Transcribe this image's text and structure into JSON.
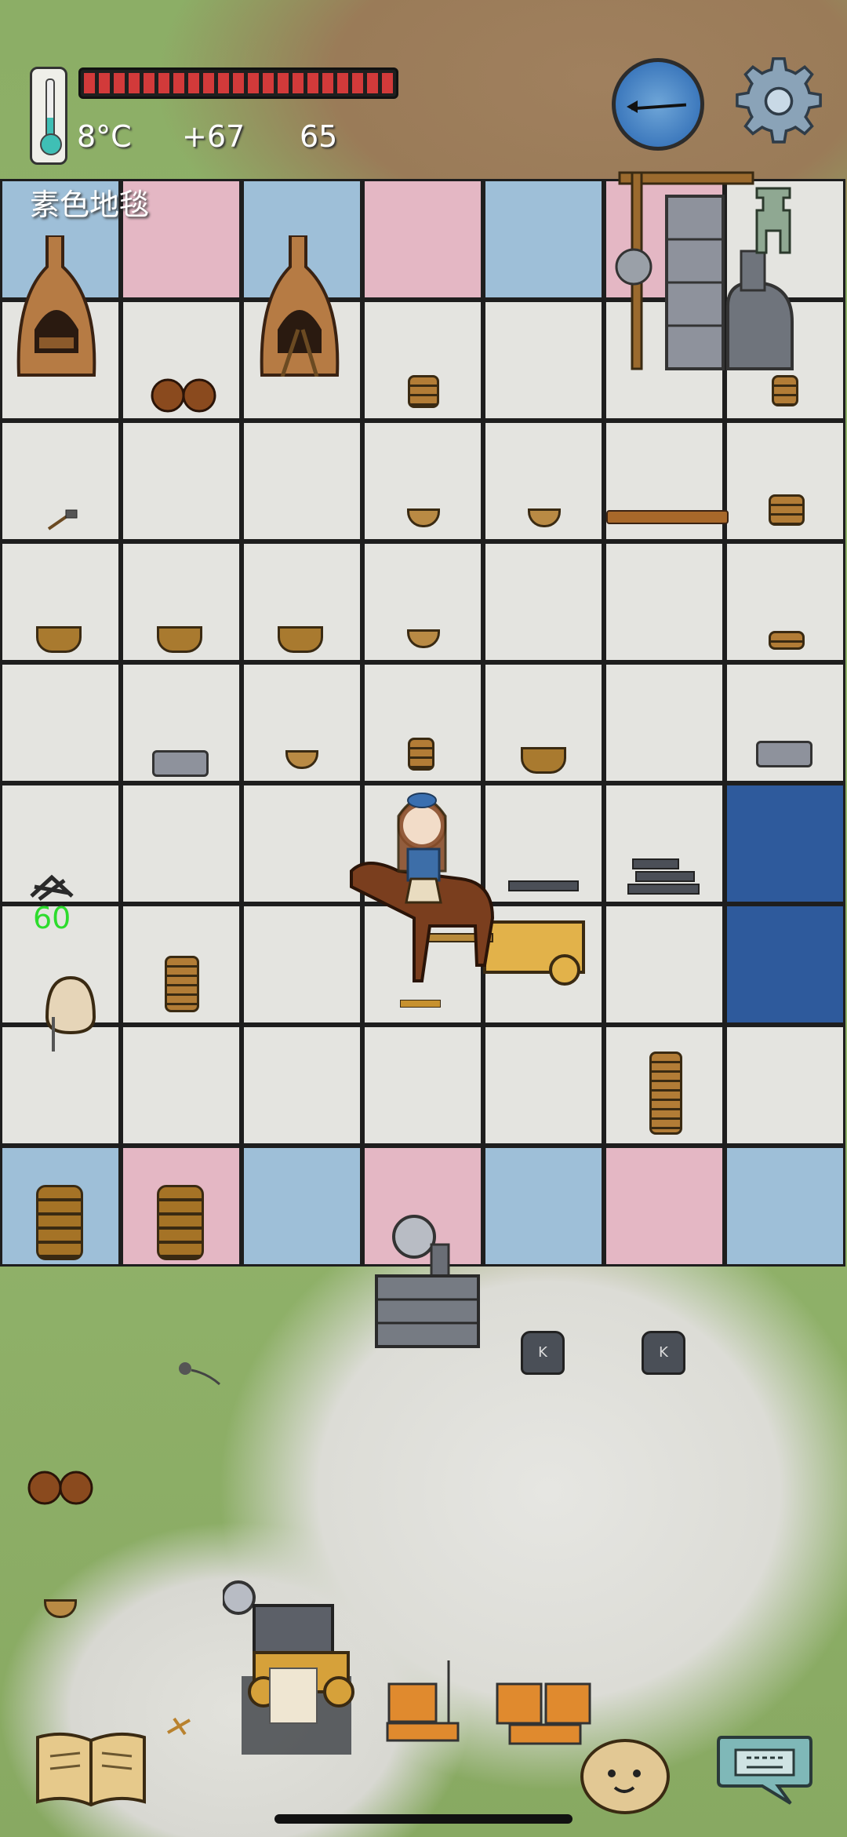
{
  "hud": {
    "temperature": "8°C",
    "food_bonus": "+67",
    "age": "65",
    "tile_name": "素色地毯"
  },
  "floor": {
    "rows": [
      [
        "blue",
        "pink",
        "blue",
        "pink",
        "blue",
        "pink",
        "white"
      ],
      [
        "white",
        "white",
        "white",
        "white",
        "white",
        "white",
        "white"
      ],
      [
        "white",
        "white",
        "white",
        "white",
        "white",
        "white",
        "white"
      ],
      [
        "white",
        "white",
        "white",
        "white",
        "white",
        "white",
        "white"
      ],
      [
        "white",
        "white",
        "white",
        "white",
        "white",
        "white",
        "white"
      ],
      [
        "white",
        "white",
        "white",
        "white",
        "white",
        "white",
        "dark"
      ],
      [
        "white",
        "white",
        "white",
        "white",
        "white",
        "white",
        "dark"
      ],
      [
        "white",
        "white",
        "white",
        "white",
        "white",
        "white",
        "white"
      ],
      [
        "blue",
        "pink",
        "blue",
        "pink",
        "blue",
        "pink",
        "blue"
      ]
    ]
  },
  "item_count": "60",
  "icons": {
    "thermometer": "thermometer-icon",
    "compass": "compass-icon",
    "settings": "gear-icon",
    "tech_tree": "recipe-book-icon",
    "emote": "emote-face-icon",
    "chat": "keyboard-chat-icon"
  },
  "colors": {
    "food_bar": "#d23a3a",
    "temperature_fill": "#3fbfb5",
    "count_text": "#2ddc2d"
  }
}
